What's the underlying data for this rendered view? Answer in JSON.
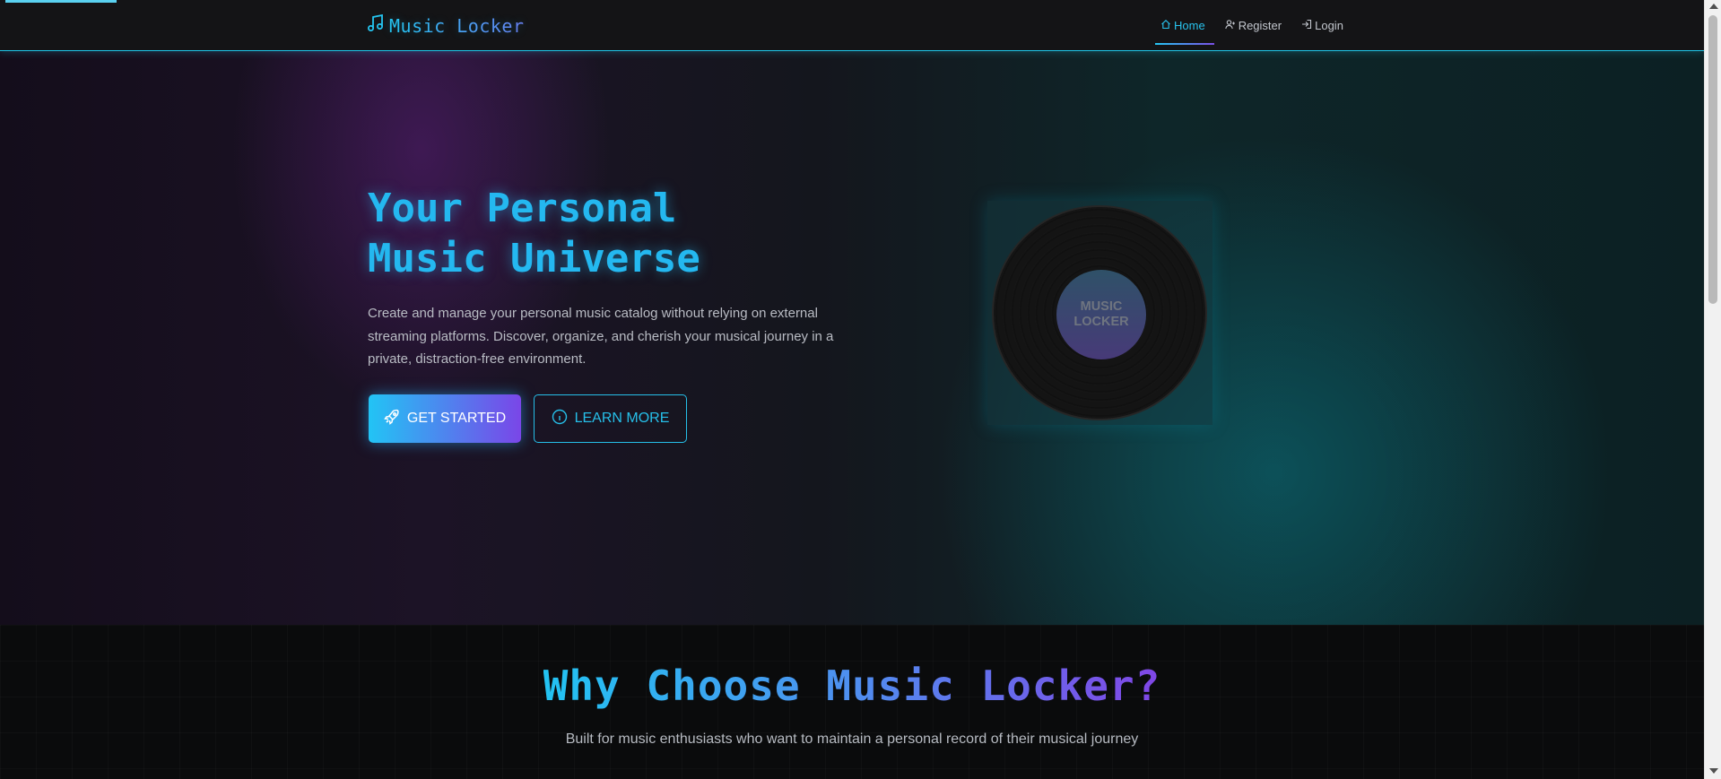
{
  "navbar": {
    "brand": "Music Locker",
    "links": [
      {
        "label": "Home",
        "icon": "home-icon",
        "active": true
      },
      {
        "label": "Register",
        "icon": "user-plus-icon",
        "active": false
      },
      {
        "label": "Login",
        "icon": "login-icon",
        "active": false
      }
    ]
  },
  "hero": {
    "title_line1": "Your Personal",
    "title_line2": "Music Universe",
    "description": "Create and manage your personal music catalog without relying on external streaming platforms. Discover, organize, and cherish your musical journey in a private, distraction-free environment.",
    "primary_button": "GET STARTED",
    "secondary_button": "LEARN MORE",
    "vinyl_label": "MUSIC\nLOCKER"
  },
  "features": {
    "title": "Why Choose Music Locker?",
    "subtitle": "Built for music enthusiasts who want to maintain a personal record of their musical journey"
  },
  "colors": {
    "accent": "#26bfe9",
    "accent_purple": "#7a46e8",
    "background": "#0b0b0d"
  }
}
